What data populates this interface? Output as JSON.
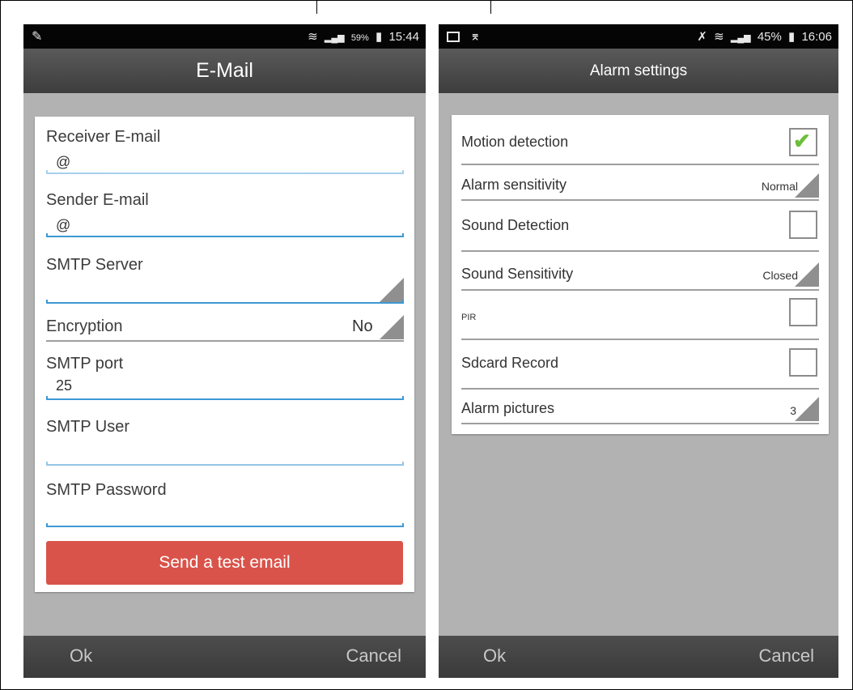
{
  "left_phone": {
    "status": {
      "battery": "59%",
      "time": "15:44"
    },
    "title": "E-Mail",
    "fields": {
      "receiver": {
        "label": "Receiver E-mail",
        "value": "@"
      },
      "sender": {
        "label": "Sender E-mail",
        "value": "@"
      },
      "smtp_server": {
        "label": "SMTP Server",
        "value": ""
      },
      "encryption": {
        "label": "Encryption",
        "value": "No"
      },
      "smtp_port": {
        "label": "SMTP port",
        "value": "25"
      },
      "smtp_user": {
        "label": "SMTP User",
        "value": ""
      },
      "smtp_password": {
        "label": "SMTP Password",
        "value": ""
      }
    },
    "send_button": "Send a test email",
    "ok": "Ok",
    "cancel": "Cancel"
  },
  "right_phone": {
    "status": {
      "battery": "45%",
      "time": "16:06"
    },
    "title": "Alarm settings",
    "rows": {
      "motion_detection": {
        "label": "Motion detection",
        "checked": true
      },
      "alarm_sensitivity": {
        "label": "Alarm sensitivity",
        "value": "Normal"
      },
      "sound_detection": {
        "label": "Sound Detection",
        "checked": false
      },
      "sound_sensitivity": {
        "label": "Sound Sensitivity",
        "value": "Closed"
      },
      "pir": {
        "label": "PIR",
        "checked": false
      },
      "sdcard_record": {
        "label": "Sdcard Record",
        "checked": false
      },
      "alarm_pictures": {
        "label": "Alarm pictures",
        "value": "3"
      }
    },
    "ok": "Ok",
    "cancel": "Cancel"
  },
  "icons": {
    "check": "✔",
    "pen": "✎",
    "wifi": "≋",
    "signal": "▂▄▆",
    "battery": "▮"
  },
  "colors": {
    "accent_line": "#3d98d4",
    "send_button": "#d9534a",
    "checkmark": "#6cbf3a",
    "screen_background": "#b2b2b2"
  }
}
